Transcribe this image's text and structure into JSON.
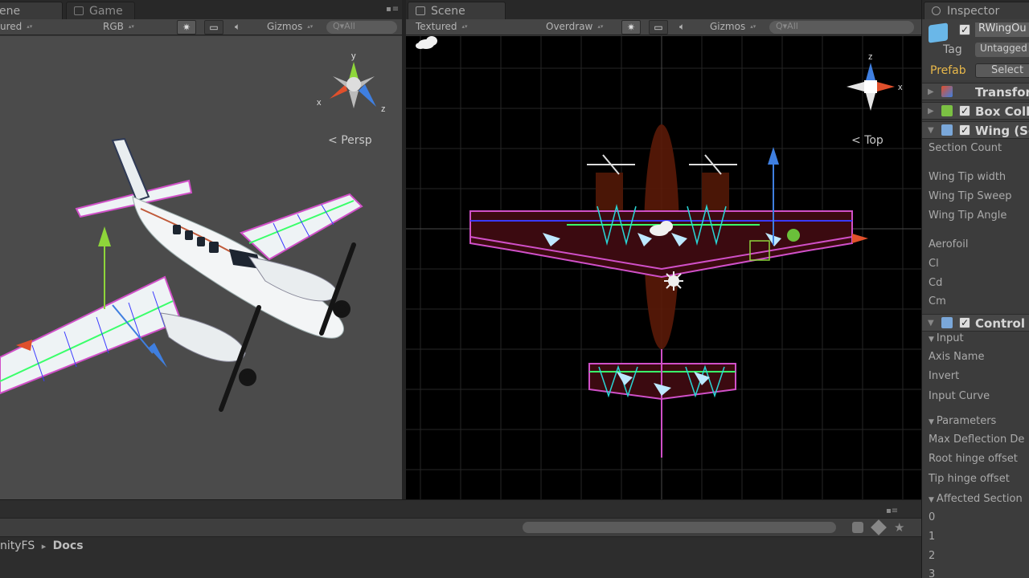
{
  "left_panel": {
    "tabs": [
      {
        "label": "ene"
      },
      {
        "label": "Game"
      }
    ],
    "toolbar": {
      "draw_mode": "ured",
      "render_mode": "RGB",
      "gizmos": "Gizmos",
      "search_placeholder": "Q▾All"
    },
    "view_label": "Persp",
    "gizmo_axes": {
      "y": "y",
      "x": "x",
      "z": "z"
    }
  },
  "center_panel": {
    "tab": {
      "label": "Scene"
    },
    "toolbar": {
      "draw_mode": "Textured",
      "render_mode": "Overdraw",
      "gizmos": "Gizmos",
      "search_placeholder": "Q▾All"
    },
    "view_label": "Top",
    "gizmo_axes": {
      "z": "z",
      "x": "x"
    }
  },
  "inspector": {
    "tab": {
      "label": "Inspector"
    },
    "object_name": "RWingOu",
    "tag_label": "Tag",
    "tag_value": "Untagged",
    "prefab_label": "Prefab",
    "select_label": "Select",
    "components": [
      {
        "label": "Transfor",
        "icon_color": "#d9873a"
      },
      {
        "label": "Box Coll",
        "icon_color": "#7bc043"
      },
      {
        "label": "Wing (Sc",
        "icon_color": "#7aa7d9"
      },
      {
        "label": "Control S",
        "icon_color": "#7aa7d9"
      }
    ],
    "wing_fields": [
      "Section Count",
      "Wing Tip width",
      "Wing Tip Sweep",
      "Wing Tip Angle"
    ],
    "aero_fields": [
      "Aerofoil",
      "Cl",
      "Cd",
      "Cm"
    ],
    "input_header": "Input",
    "input_fields": [
      "Axis Name",
      "Invert",
      "Input Curve"
    ],
    "parameters_header": "Parameters",
    "parameter_fields": [
      "Max Deflection De",
      "Root hinge offset",
      "Tip hinge offset"
    ],
    "affected_header": "Affected Section",
    "affected_values": [
      "0",
      "1",
      "2",
      "3"
    ]
  },
  "project": {
    "breadcrumb_root": "nityFS",
    "breadcrumb_sep": "▸",
    "breadcrumb_leaf": "Docs"
  },
  "colors": {
    "x_axis": "#e0502c",
    "y_axis": "#8ed63a",
    "z_axis": "#3f7fe0",
    "wing_mesh_pink": "#d050c8",
    "wing_mesh_blue": "#3a3aff",
    "wing_mesh_green": "#3aff6a",
    "scene_bg": "#000000",
    "game_bg": "#4b4b4b"
  }
}
